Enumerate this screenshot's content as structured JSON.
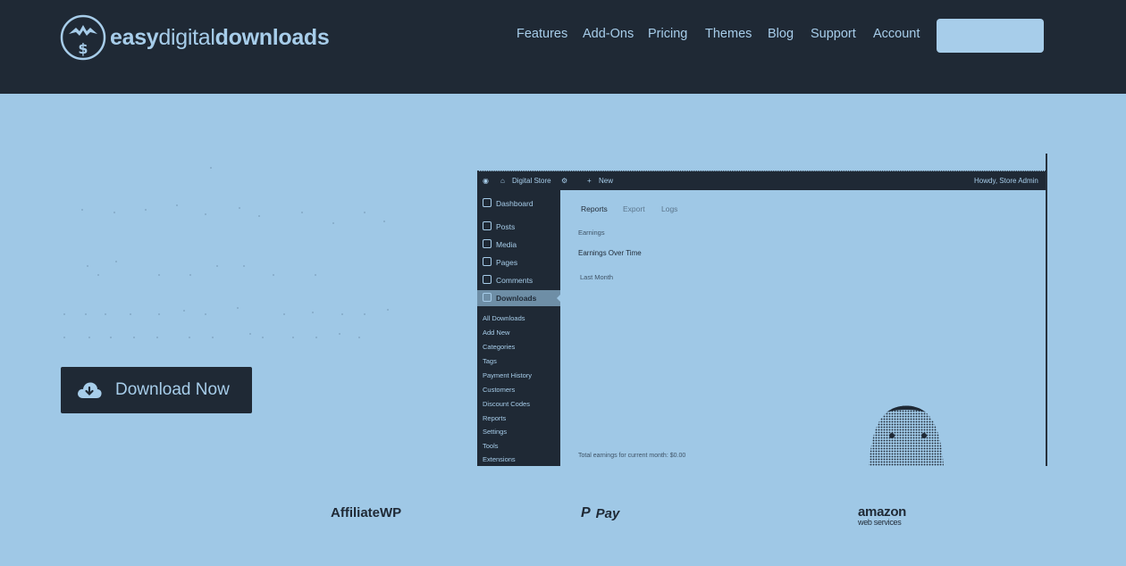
{
  "brand": {
    "logo_part1": "easy",
    "logo_part2": "digital",
    "logo_part3": "downloads",
    "text_color": "#a7cdea",
    "dark_color": "#1f2935",
    "hero_bg": "#9fc8e6"
  },
  "nav": {
    "items": [
      {
        "label": "Features"
      },
      {
        "label": "Add-Ons"
      },
      {
        "label": "Pricing"
      },
      {
        "label": "Themes"
      },
      {
        "label": "Blog"
      },
      {
        "label": "Support"
      },
      {
        "label": "Account"
      }
    ]
  },
  "hero": {
    "download_label": "Download Now",
    "download_icon": "cloud-download-icon"
  },
  "screenshot": {
    "adminbar": {
      "site_name": "Digital Store",
      "new_label": "New",
      "howdy": "Howdy, Store Admin"
    },
    "sidebar": {
      "top_items": [
        {
          "label": "Dashboard"
        },
        {
          "label": "Posts"
        },
        {
          "label": "Media"
        },
        {
          "label": "Pages"
        },
        {
          "label": "Comments"
        },
        {
          "label": "Downloads"
        }
      ],
      "sub_items": [
        {
          "label": "All Downloads"
        },
        {
          "label": "Add New"
        },
        {
          "label": "Categories"
        },
        {
          "label": "Tags"
        },
        {
          "label": "Payment History"
        },
        {
          "label": "Customers"
        },
        {
          "label": "Discount Codes"
        },
        {
          "label": "Reports"
        },
        {
          "label": "Settings"
        },
        {
          "label": "Tools"
        },
        {
          "label": "Extensions"
        }
      ]
    },
    "main": {
      "tabs": [
        {
          "label": "Reports"
        },
        {
          "label": "Export"
        },
        {
          "label": "Logs"
        }
      ],
      "filter_label": "Earnings",
      "heading": "Earnings Over Time",
      "period_select": "Last Month",
      "footer_note": "Total earnings for current month: $0.00"
    }
  },
  "partners": {
    "affiliate": "AffiliateWP",
    "paypal": "Pay",
    "amazon_1": "amazon",
    "amazon_2": "web services"
  }
}
